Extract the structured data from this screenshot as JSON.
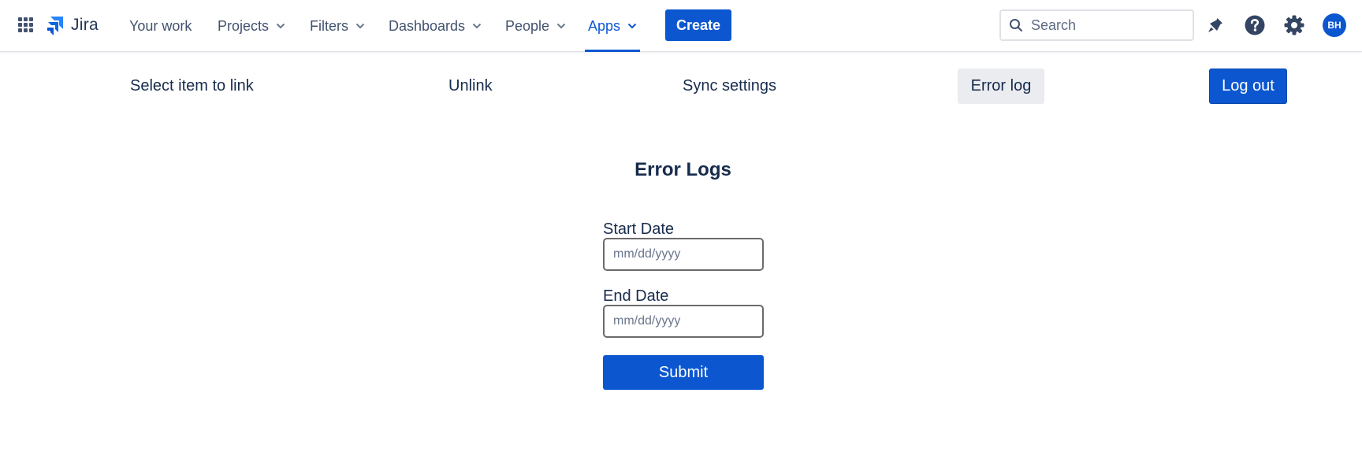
{
  "header": {
    "logo_text": "Jira",
    "nav": [
      {
        "label": "Your work",
        "dropdown": false,
        "active": false
      },
      {
        "label": "Projects",
        "dropdown": true,
        "active": false
      },
      {
        "label": "Filters",
        "dropdown": true,
        "active": false
      },
      {
        "label": "Dashboards",
        "dropdown": true,
        "active": false
      },
      {
        "label": "People",
        "dropdown": true,
        "active": false
      },
      {
        "label": "Apps",
        "dropdown": true,
        "active": true
      }
    ],
    "create_label": "Create",
    "search": {
      "placeholder": "Search",
      "value": ""
    },
    "icons": [
      "app-switcher-icon",
      "notifications-icon",
      "help-icon",
      "settings-icon"
    ],
    "avatar_initials": "BH"
  },
  "subnav": {
    "items": [
      {
        "label": "Select item to link",
        "selected": false
      },
      {
        "label": "Unlink",
        "selected": false
      },
      {
        "label": "Sync settings",
        "selected": false
      },
      {
        "label": "Error log",
        "selected": true
      }
    ],
    "logout_label": "Log out"
  },
  "main": {
    "title": "Error Logs",
    "start_date": {
      "label": "Start Date",
      "placeholder": "mm/dd/yyyy",
      "value": ""
    },
    "end_date": {
      "label": "End Date",
      "placeholder": "mm/dd/yyyy",
      "value": ""
    },
    "submit_label": "Submit"
  },
  "colors": {
    "primary": "#0c57d0",
    "text": "#172b4d",
    "nav_text": "#42526e",
    "selected_bg": "#ebecf0"
  }
}
